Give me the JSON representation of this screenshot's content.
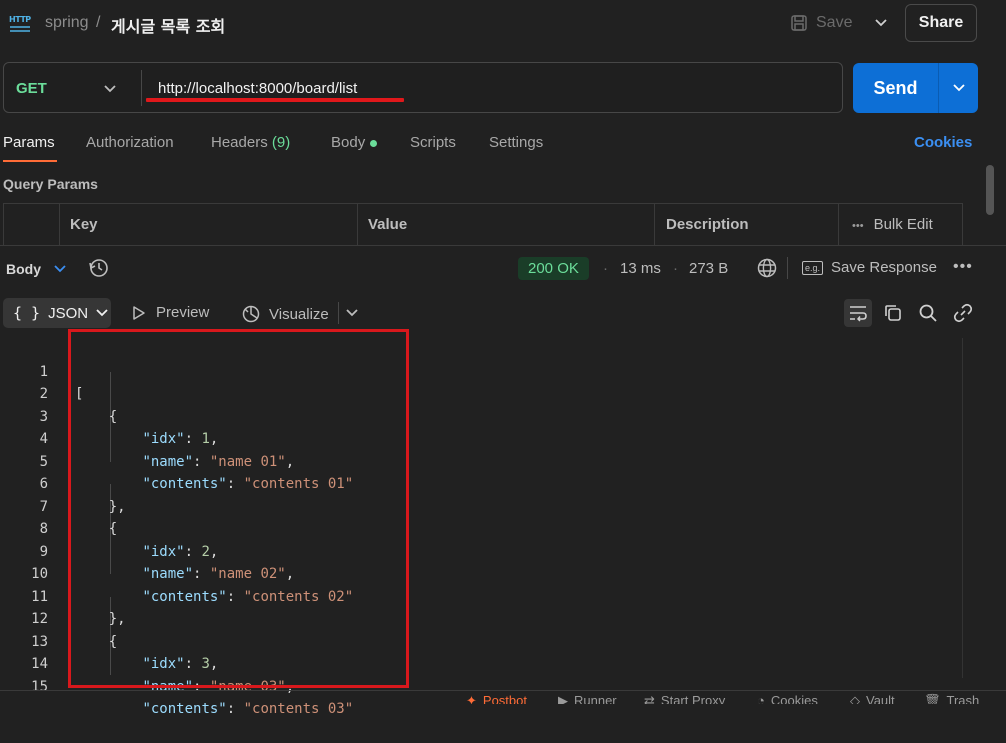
{
  "header": {
    "breadcrumb_parent": "spring",
    "breadcrumb_sep": "/",
    "title": "게시글 목록 조회",
    "save_label": "Save",
    "share_label": "Share",
    "http_icon": "HTTP"
  },
  "request": {
    "method": "GET",
    "url": "http://localhost:8000/board/list",
    "send_label": "Send"
  },
  "tabs": {
    "params": "Params",
    "authorization": "Authorization",
    "headers": "Headers",
    "headers_count": "(9)",
    "body": "Body",
    "scripts": "Scripts",
    "settings": "Settings",
    "cookies": "Cookies"
  },
  "query_params": {
    "title": "Query Params",
    "columns": [
      "Key",
      "Value",
      "Description"
    ],
    "bulk_edit": "Bulk Edit"
  },
  "response": {
    "body_label": "Body",
    "status": "200 OK",
    "time": "13 ms",
    "size": "273 B",
    "save_response": "Save Response",
    "eg": "e.g."
  },
  "viewer": {
    "format": "JSON",
    "braces": "{ }",
    "preview": "Preview",
    "visualize": "Visualize"
  },
  "code_lines": [
    {
      "n": "1"
    },
    {
      "n": "2"
    },
    {
      "n": "3"
    },
    {
      "n": "4"
    },
    {
      "n": "5"
    },
    {
      "n": "6"
    },
    {
      "n": "7"
    },
    {
      "n": "8"
    },
    {
      "n": "9"
    },
    {
      "n": "10"
    },
    {
      "n": "11"
    },
    {
      "n": "12"
    },
    {
      "n": "13"
    },
    {
      "n": "14"
    },
    {
      "n": "15"
    }
  ],
  "records": [
    {
      "idx": "1",
      "name": "\"name 01\"",
      "contents": "\"contents 01\""
    },
    {
      "idx": "2",
      "name": "\"name 02\"",
      "contents": "\"contents 02\""
    },
    {
      "idx": "3",
      "name": "\"name 03\"",
      "contents": "\"contents 03\""
    }
  ],
  "keys": {
    "idx": "\"idx\"",
    "name": "\"name\"",
    "contents": "\"contents\""
  },
  "footer": {
    "postbot": "Postbot",
    "runner": "Runner",
    "start_proxy": "Start Proxy",
    "cookies": "Cookies",
    "vault": "Vault",
    "trash": "Trash"
  },
  "colors": {
    "accent_blue": "#0d6fd6",
    "method_green": "#6bdd9a",
    "highlight_red": "#d8181c",
    "brand_orange": "#ff6c37"
  }
}
